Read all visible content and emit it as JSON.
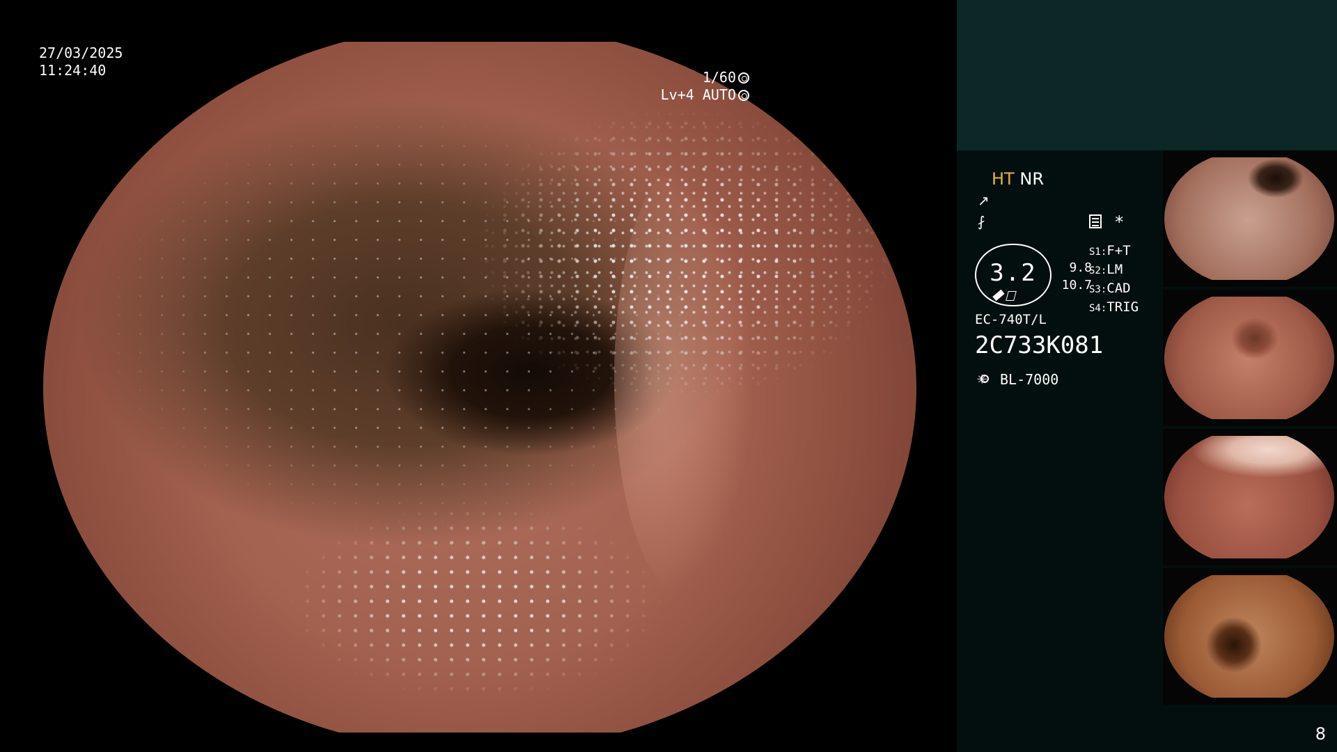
{
  "overlay": {
    "date": "27/03/2025",
    "time": "11:24:40",
    "shutter": "1/60",
    "shutter_icon": "aperture-icon",
    "level": "Lv+4 AUTO",
    "level_icon": "auto-iris-icon"
  },
  "panel": {
    "ht_label": "HT",
    "nr_label": "NR",
    "enhance_icon_1": "↗",
    "enhance_icon_2": "⨏",
    "settings_icon": "settings-icon",
    "star": "*",
    "gauge_value": "3.2",
    "num_1": "9.8",
    "num_2": "10.7",
    "slots": [
      {
        "key": "S1:",
        "value": "F+T"
      },
      {
        "key": "S2:",
        "value": "LM"
      },
      {
        "key": "S3:",
        "value": "CAD"
      },
      {
        "key": "S4:",
        "value": "TRIG"
      }
    ],
    "scope_model": "EC-740T/L",
    "scope_serial": "2C733K081",
    "light_source": "BL-7000",
    "light_icon": "light-source-icon",
    "page_number": "8"
  },
  "colors": {
    "accent_ht": "#e8b23a",
    "panel_top": "#0b2726",
    "panel_bg": "#030f0e"
  }
}
